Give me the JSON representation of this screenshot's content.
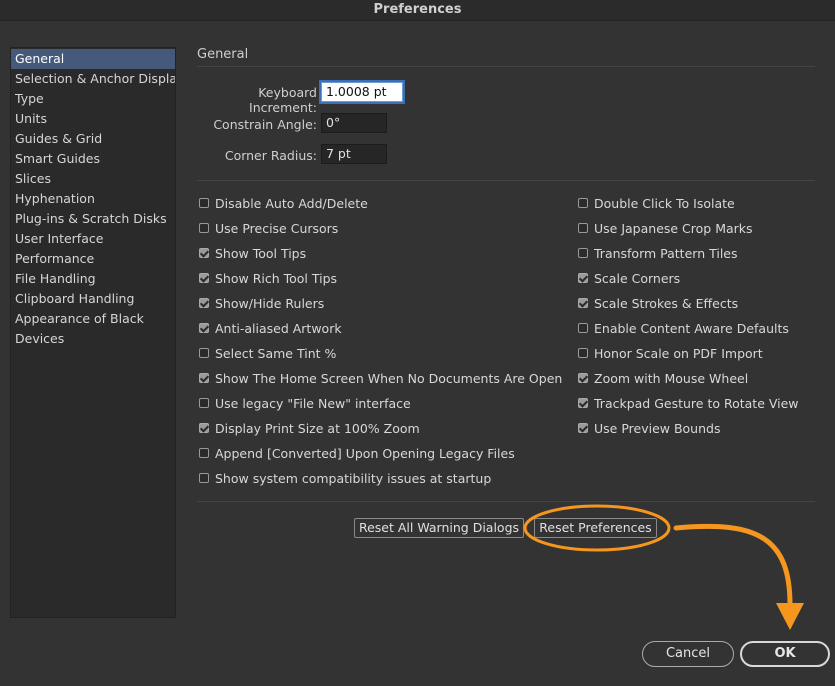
{
  "window": {
    "title": "Preferences"
  },
  "sidebar": {
    "items": [
      {
        "label": "General",
        "selected": true
      },
      {
        "label": "Selection & Anchor Display"
      },
      {
        "label": "Type"
      },
      {
        "label": "Units"
      },
      {
        "label": "Guides & Grid"
      },
      {
        "label": "Smart Guides"
      },
      {
        "label": "Slices"
      },
      {
        "label": "Hyphenation"
      },
      {
        "label": "Plug-ins & Scratch Disks"
      },
      {
        "label": "User Interface"
      },
      {
        "label": "Performance"
      },
      {
        "label": "File Handling"
      },
      {
        "label": "Clipboard Handling"
      },
      {
        "label": "Appearance of Black"
      },
      {
        "label": "Devices"
      }
    ]
  },
  "main": {
    "section_title": "General",
    "fields": {
      "keyboard_increment": {
        "label": "Keyboard Increment:",
        "value": "1.0008 pt"
      },
      "constrain_angle": {
        "label": "Constrain Angle:",
        "value": "0°"
      },
      "corner_radius": {
        "label": "Corner Radius:",
        "value": "7 pt"
      }
    },
    "left_options": [
      {
        "label": "Disable Auto Add/Delete",
        "checked": false
      },
      {
        "label": "Use Precise Cursors",
        "checked": false
      },
      {
        "label": "Show Tool Tips",
        "checked": true
      },
      {
        "label": "Show Rich Tool Tips",
        "checked": true
      },
      {
        "label": "Show/Hide Rulers",
        "checked": true
      },
      {
        "label": "Anti-aliased Artwork",
        "checked": true
      },
      {
        "label": "Select Same Tint %",
        "checked": false
      },
      {
        "label": "Show The Home Screen When No Documents Are Open",
        "checked": true
      },
      {
        "label": "Use legacy \"File New\" interface",
        "checked": false
      },
      {
        "label": "Display Print Size at 100% Zoom",
        "checked": true
      },
      {
        "label": "Append [Converted] Upon Opening Legacy Files",
        "checked": false
      },
      {
        "label": "Show system compatibility issues at startup",
        "checked": false
      }
    ],
    "right_options": [
      {
        "label": "Double Click To Isolate",
        "checked": false
      },
      {
        "label": "Use Japanese Crop Marks",
        "checked": false
      },
      {
        "label": "Transform Pattern Tiles",
        "checked": false
      },
      {
        "label": "Scale Corners",
        "checked": true
      },
      {
        "label": "Scale Strokes & Effects",
        "checked": true
      },
      {
        "label": "Enable Content Aware Defaults",
        "checked": false
      },
      {
        "label": "Honor Scale on PDF Import",
        "checked": false
      },
      {
        "label": "Zoom with Mouse Wheel",
        "checked": true
      },
      {
        "label": "Trackpad Gesture to Rotate View",
        "checked": true
      },
      {
        "label": "Use Preview Bounds",
        "checked": true
      }
    ],
    "reset_warnings_label": "Reset All Warning Dialogs",
    "reset_prefs_label": "Reset Preferences"
  },
  "footer": {
    "cancel_label": "Cancel",
    "ok_label": "OK"
  },
  "colors": {
    "background": "#333333",
    "selected_item": "#45597a",
    "annotation": "#f5961e"
  }
}
